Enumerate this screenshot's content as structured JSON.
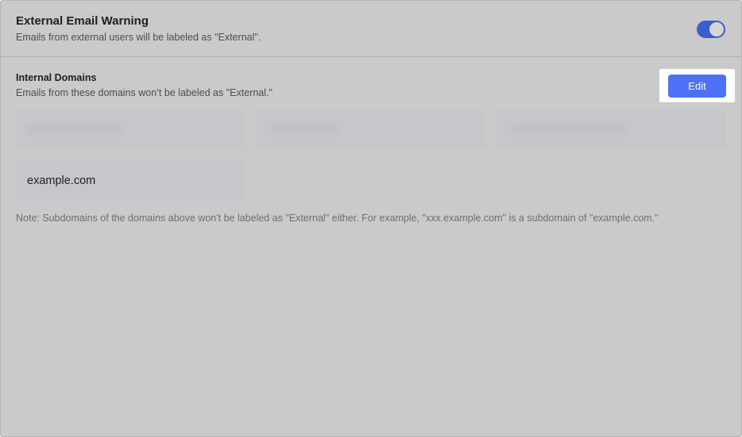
{
  "external_warning": {
    "title": "External Email Warning",
    "description": "Emails from external users will be labeled as \"External\".",
    "enabled": true,
    "toggle_color": "#3c5cd4"
  },
  "internal_domains": {
    "title": "Internal Domains",
    "description": "Emails from these domains won’t be labeled as \"External.\"",
    "edit_label": "Edit",
    "edit_color": "#4e70f6",
    "domains": [
      "",
      "",
      "",
      "example.com"
    ],
    "note": "Note: Subdomains of the domains above won't be labeled as \"External\" either. For example, \"xxx.example.com\" is a subdomain of \"example.com.\""
  }
}
